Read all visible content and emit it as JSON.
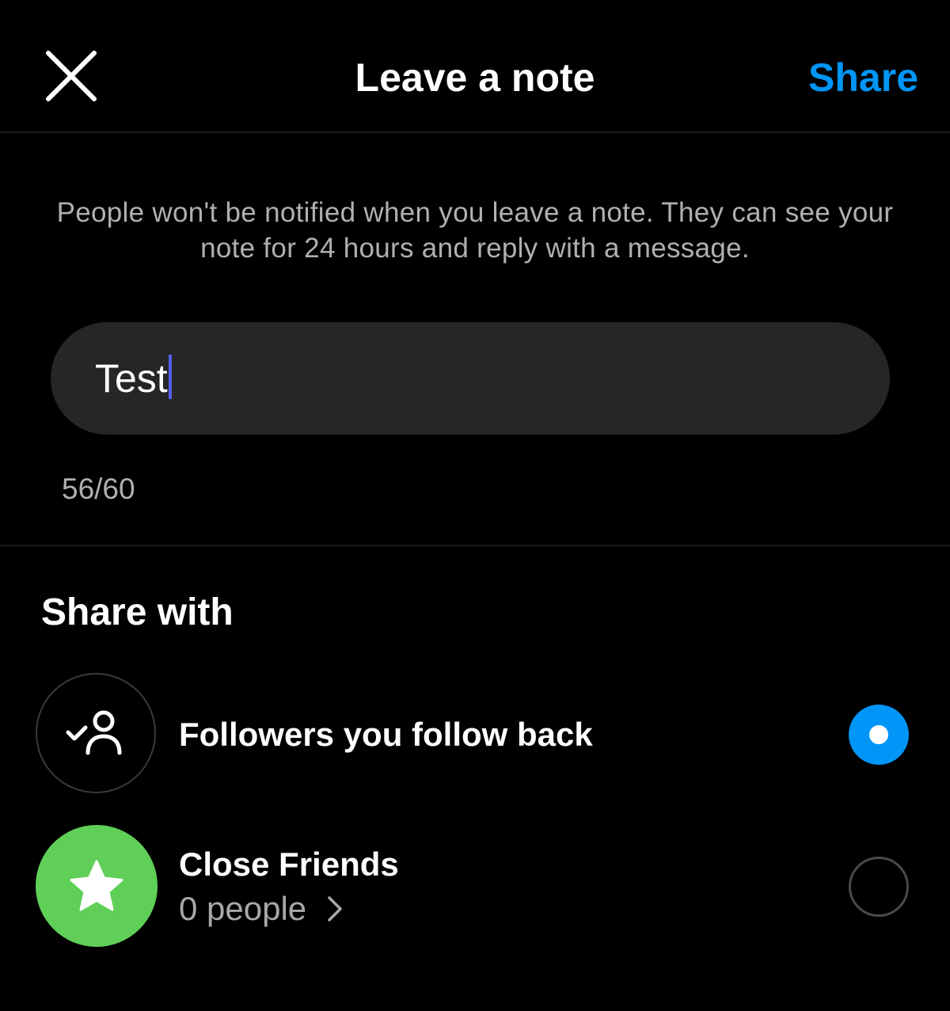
{
  "header": {
    "title": "Leave a note",
    "share_label": "Share",
    "close_icon": "close-icon"
  },
  "info_text": "People won't be notified when you leave a note. They can see your note for 24 hours and reply with a message.",
  "note": {
    "value": "Test",
    "char_count": "56/60"
  },
  "share_with": {
    "title": "Share with",
    "options": [
      {
        "label": "Followers you follow back",
        "icon": "followers-check-icon",
        "selected": true
      },
      {
        "label": "Close Friends",
        "sub_label": "0 people",
        "icon": "star-icon",
        "selected": false
      }
    ]
  },
  "colors": {
    "background": "#000000",
    "accent_blue": "#0095f6",
    "close_friends_green": "#5fcf58",
    "caret": "#5560f0",
    "input_background": "#262626",
    "secondary_text": "#b0b0b3"
  }
}
